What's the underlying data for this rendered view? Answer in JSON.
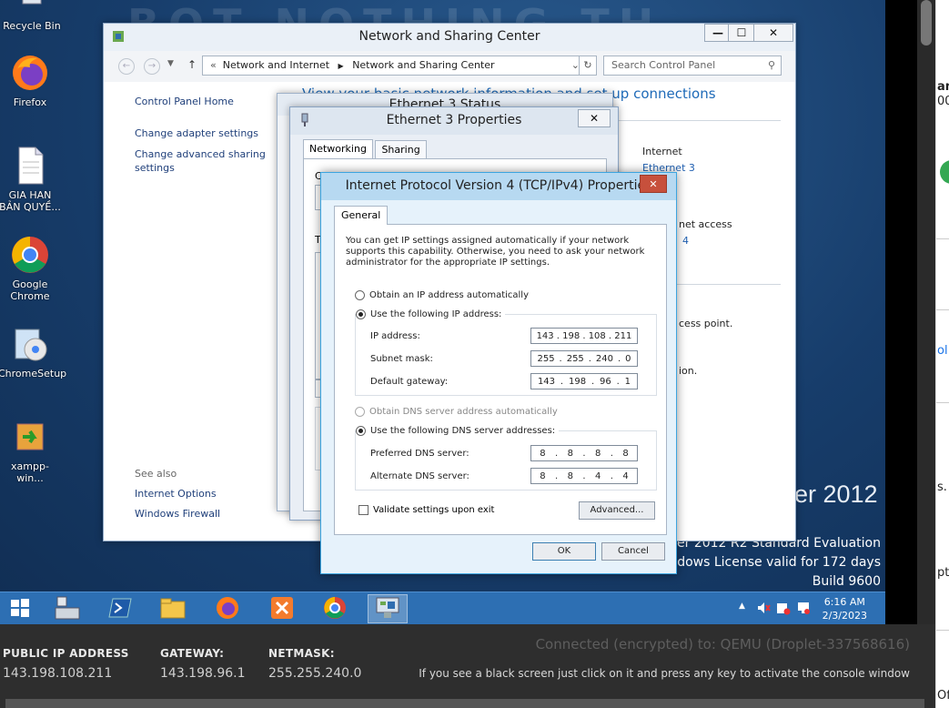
{
  "desktop": {
    "icons": [
      {
        "label": "Recycle Bin"
      },
      {
        "label": "Firefox"
      },
      {
        "label": "GIA HAN BẢN QUYỀ..."
      },
      {
        "label": "Google Chrome"
      },
      {
        "label": "ChromeSetup"
      },
      {
        "label": "xampp-win..."
      }
    ],
    "watermark": {
      "brand": "er 2012",
      "edition": "Server 2012 R2 Standard Evaluation",
      "license": "Windows License valid for 172 days",
      "build": "Build 9600"
    }
  },
  "network_center": {
    "title": "Network and Sharing Center",
    "breadcrumb": {
      "root": "Network and Internet",
      "current": "Network and Sharing Center"
    },
    "search_placeholder": "Search Control Panel",
    "heading": "View your basic network information and set up connections",
    "left_links": [
      "Control Panel Home",
      "Change adapter settings",
      "Change advanced sharing settings"
    ],
    "see_also_label": "See also",
    "see_also_links": [
      "Internet Options",
      "Windows Firewall"
    ],
    "right_fragments": {
      "internet": "Internet",
      "ethernet": "Ethernet 3",
      "net_access": "net access",
      "four": "4",
      "access_point": "cess point.",
      "ion": "ion."
    },
    "window_buttons": {
      "minimize": "—",
      "maximize": "☐",
      "close": "✕"
    }
  },
  "ethernet_status": {
    "title": "Ethernet 3 Status"
  },
  "ethernet_props": {
    "title": "Ethernet 3 Properties",
    "tabs": [
      "Networking",
      "Sharing"
    ],
    "frag_c": "C",
    "frag_t": "T",
    "close": "✕"
  },
  "ipv4": {
    "title": "Internet Protocol Version 4 (TCP/IPv4) Properties",
    "close": "✕",
    "tab": "General",
    "description": "You can get IP settings assigned automatically if your network supports this capability. Otherwise, you need to ask your network administrator for the appropriate IP settings.",
    "obtain_ip_auto": "Obtain an IP address automatically",
    "use_following_ip": "Use the following IP address:",
    "ip_address_label": "IP address:",
    "ip_address": [
      "143",
      "198",
      "108",
      "211"
    ],
    "subnet_label": "Subnet mask:",
    "subnet": [
      "255",
      "255",
      "240",
      "0"
    ],
    "gateway_label": "Default gateway:",
    "gateway": [
      "143",
      "198",
      "96",
      "1"
    ],
    "obtain_dns_auto": "Obtain DNS server address automatically",
    "use_following_dns": "Use the following DNS server addresses:",
    "preferred_dns_label": "Preferred DNS server:",
    "preferred_dns": [
      "8",
      "8",
      "8",
      "8"
    ],
    "alternate_dns_label": "Alternate DNS server:",
    "alternate_dns": [
      "8",
      "8",
      "4",
      "4"
    ],
    "validate_label": "Validate settings upon exit",
    "validate_checked": false,
    "advanced_label": "Advanced...",
    "ok_label": "OK",
    "cancel_label": "Cancel"
  },
  "taskbar": {
    "time": "6:16 AM",
    "date": "2/3/2023"
  },
  "console_info": {
    "public_ip_label": "PUBLIC IP ADDRESS",
    "public_ip": "143.198.108.211",
    "gateway_label": "GATEWAY:",
    "gateway": "143.198.96.1",
    "netmask_label": "NETMASK:",
    "netmask": "255.255.240.0",
    "connected": "Connected (encrypted) to: QEMU (Droplet-337568616)",
    "hint": "If you see a black screen just click on it and press any key to activate the console window"
  },
  "right_edge": {
    "frag1": "am",
    "frag2": "00",
    "frag3": "ol",
    "frag4": "s.",
    "frag5": "pt",
    "frag6": "Of"
  },
  "colors": {
    "desktop_bg": "#173d6b",
    "taskbar": "#2d6fb3",
    "dialog_accent": "#3ca5e0",
    "close_red": "#c7503c",
    "infobar": "#2e2e2e"
  }
}
